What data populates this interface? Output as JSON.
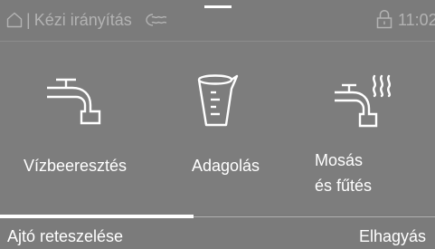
{
  "header": {
    "separator": "|",
    "title": "Kézi irányítás",
    "clock": "11:02",
    "icons": [
      "home-icon",
      "water-wave-icon",
      "lock-icon"
    ]
  },
  "tiles": [
    {
      "label": "Vízbeeresztés",
      "icon": "faucet-icon"
    },
    {
      "label": "Adagolás",
      "icon": "measuring-cup-icon"
    },
    {
      "label_line1": "Mosás",
      "label_line2": "és fűtés",
      "icon": "faucet-heat-icon"
    }
  ],
  "footer": {
    "left_label": "Ajtó reteszelése",
    "right_label": "Elhagyás"
  },
  "colors": {
    "background": "#7d7d7d",
    "foreground": "#ffffff",
    "muted": "#b3b3b3"
  }
}
